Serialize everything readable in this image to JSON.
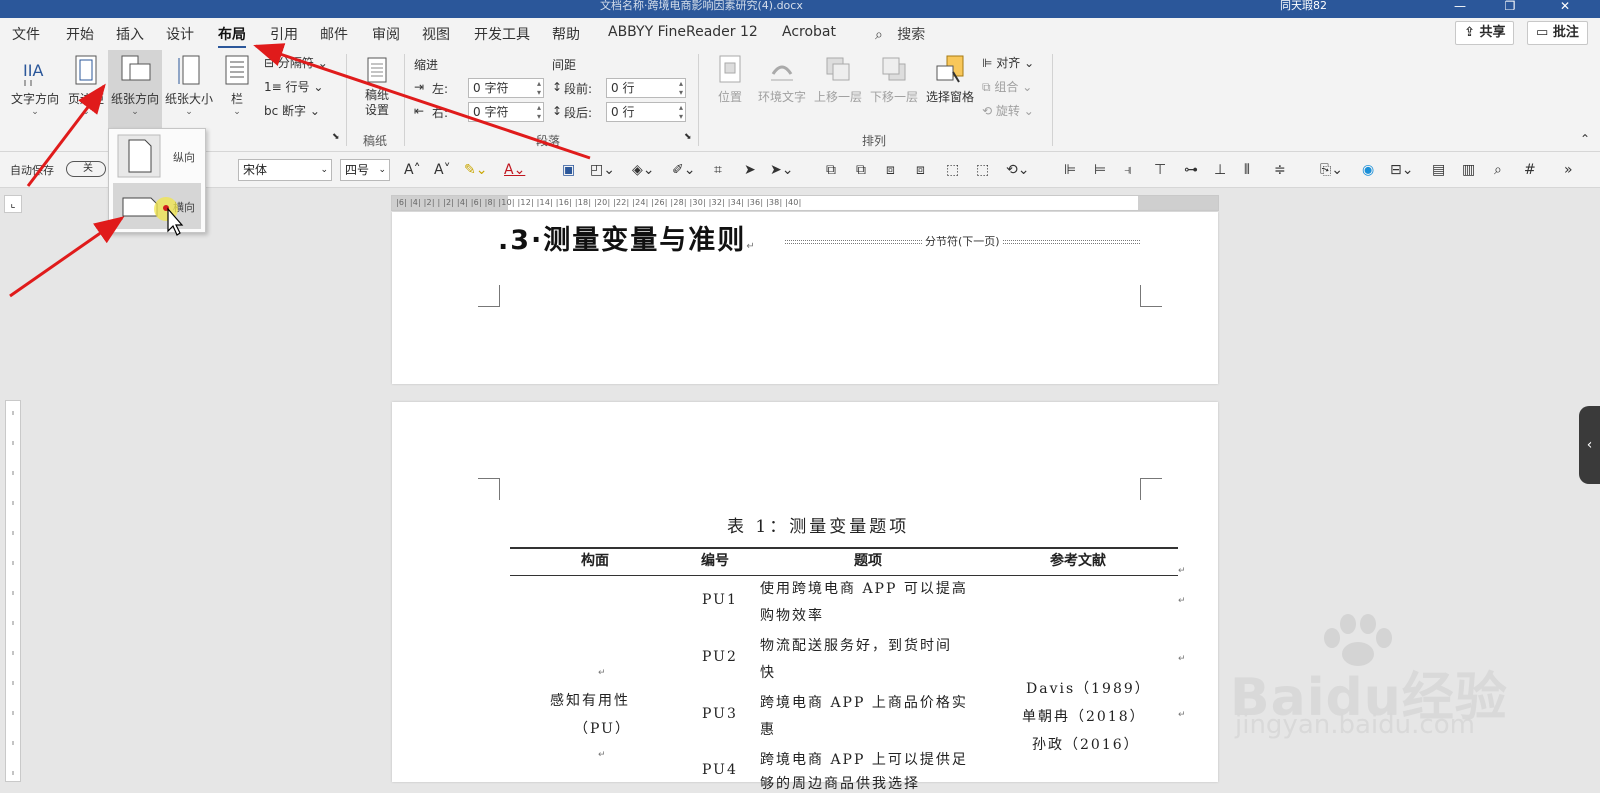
{
  "titlebar": {
    "title": "文档名称·跨境电商影响因素研究(4).docx",
    "user": "同天瑕82",
    "minimize": "—",
    "restore": "❐",
    "close": "✕"
  },
  "tabs": [
    {
      "label": "文件",
      "active": false
    },
    {
      "label": "开始",
      "active": false
    },
    {
      "label": "插入",
      "active": false
    },
    {
      "label": "设计",
      "active": false
    },
    {
      "label": "布局",
      "active": true
    },
    {
      "label": "引用",
      "active": false
    },
    {
      "label": "邮件",
      "active": false
    },
    {
      "label": "审阅",
      "active": false
    },
    {
      "label": "视图",
      "active": false
    },
    {
      "label": "开发工具",
      "active": false
    },
    {
      "label": "帮助",
      "active": false
    },
    {
      "label": "ABBYY FineReader 12",
      "active": false
    },
    {
      "label": "Acrobat",
      "active": false
    }
  ],
  "search": {
    "label": "搜索"
  },
  "share_label": "共享",
  "comment_label": "批注",
  "ribbon": {
    "page_setup": {
      "text_direction": "文字方向",
      "margins": "页边距",
      "orientation": "纸张方向",
      "size": "纸张大小",
      "columns": "栏",
      "breaks": "分隔符",
      "line_numbers": "行号",
      "hyphenation": "断字"
    },
    "draft": {
      "label": "稿纸设置",
      "group": "稿纸"
    },
    "paragraph": {
      "indent_title": "缩进",
      "spacing_title": "间距",
      "left_label": "左:",
      "right_label": "右:",
      "before_label": "段前:",
      "after_label": "段后:",
      "left_value": "0 字符",
      "right_value": "0 字符",
      "before_value": "0 行",
      "after_value": "0 行",
      "group": "段落"
    },
    "arrange": {
      "position": "位置",
      "wrap": "环境文字",
      "forward": "上移一层",
      "backward": "下移一层",
      "selection_pane": "选择窗格",
      "align": "对齐",
      "group_btn": "组合",
      "rotate": "旋转",
      "group": "排列"
    }
  },
  "orientation_menu": {
    "portrait": "纵向",
    "landscape": "横向"
  },
  "qat": {
    "autosave": "自动保存",
    "toggle": "关",
    "font": "宋体",
    "size": "四号"
  },
  "ruler_text": "|6| |4| |2| |  |2| |4| |6| |8| |10| |12| |14| |16| |18| |20| |22| |24| |26| |28| |30| |32| |34| |36| |38| |40|",
  "document": {
    "heading": ".3·测量变量与准则",
    "heading_mark": "↵",
    "section_break": "分节符(下一页)",
    "table_caption": "表 1：测量变量题项",
    "headers": [
      "构面",
      "编号",
      "题项",
      "参考文献"
    ],
    "construct": "感知有用性",
    "construct_abbr": "（PU）",
    "rows": [
      {
        "code": "PU1",
        "item_l1": "使用跨境电商 APP 可以提高",
        "item_l2": "购物效率"
      },
      {
        "code": "PU2",
        "item_l1": "物流配送服务好，到货时间",
        "item_l2": "快"
      },
      {
        "code": "PU3",
        "item_l1": "跨境电商 APP 上商品价格实",
        "item_l2": "惠"
      },
      {
        "code": "PU4",
        "item_l1": "跨境电商 APP 上可以提供足",
        "item_l2": "够的周边商品供我选择"
      }
    ],
    "references": [
      "Davis（1989）",
      "单朝冉（2018）",
      "孙政（2016）"
    ]
  },
  "watermark": {
    "line1": "Baidu经验",
    "line2": "jingyan.baidu.com"
  },
  "accent_color": "#2b579a",
  "arrow_color": "#e01b1b"
}
